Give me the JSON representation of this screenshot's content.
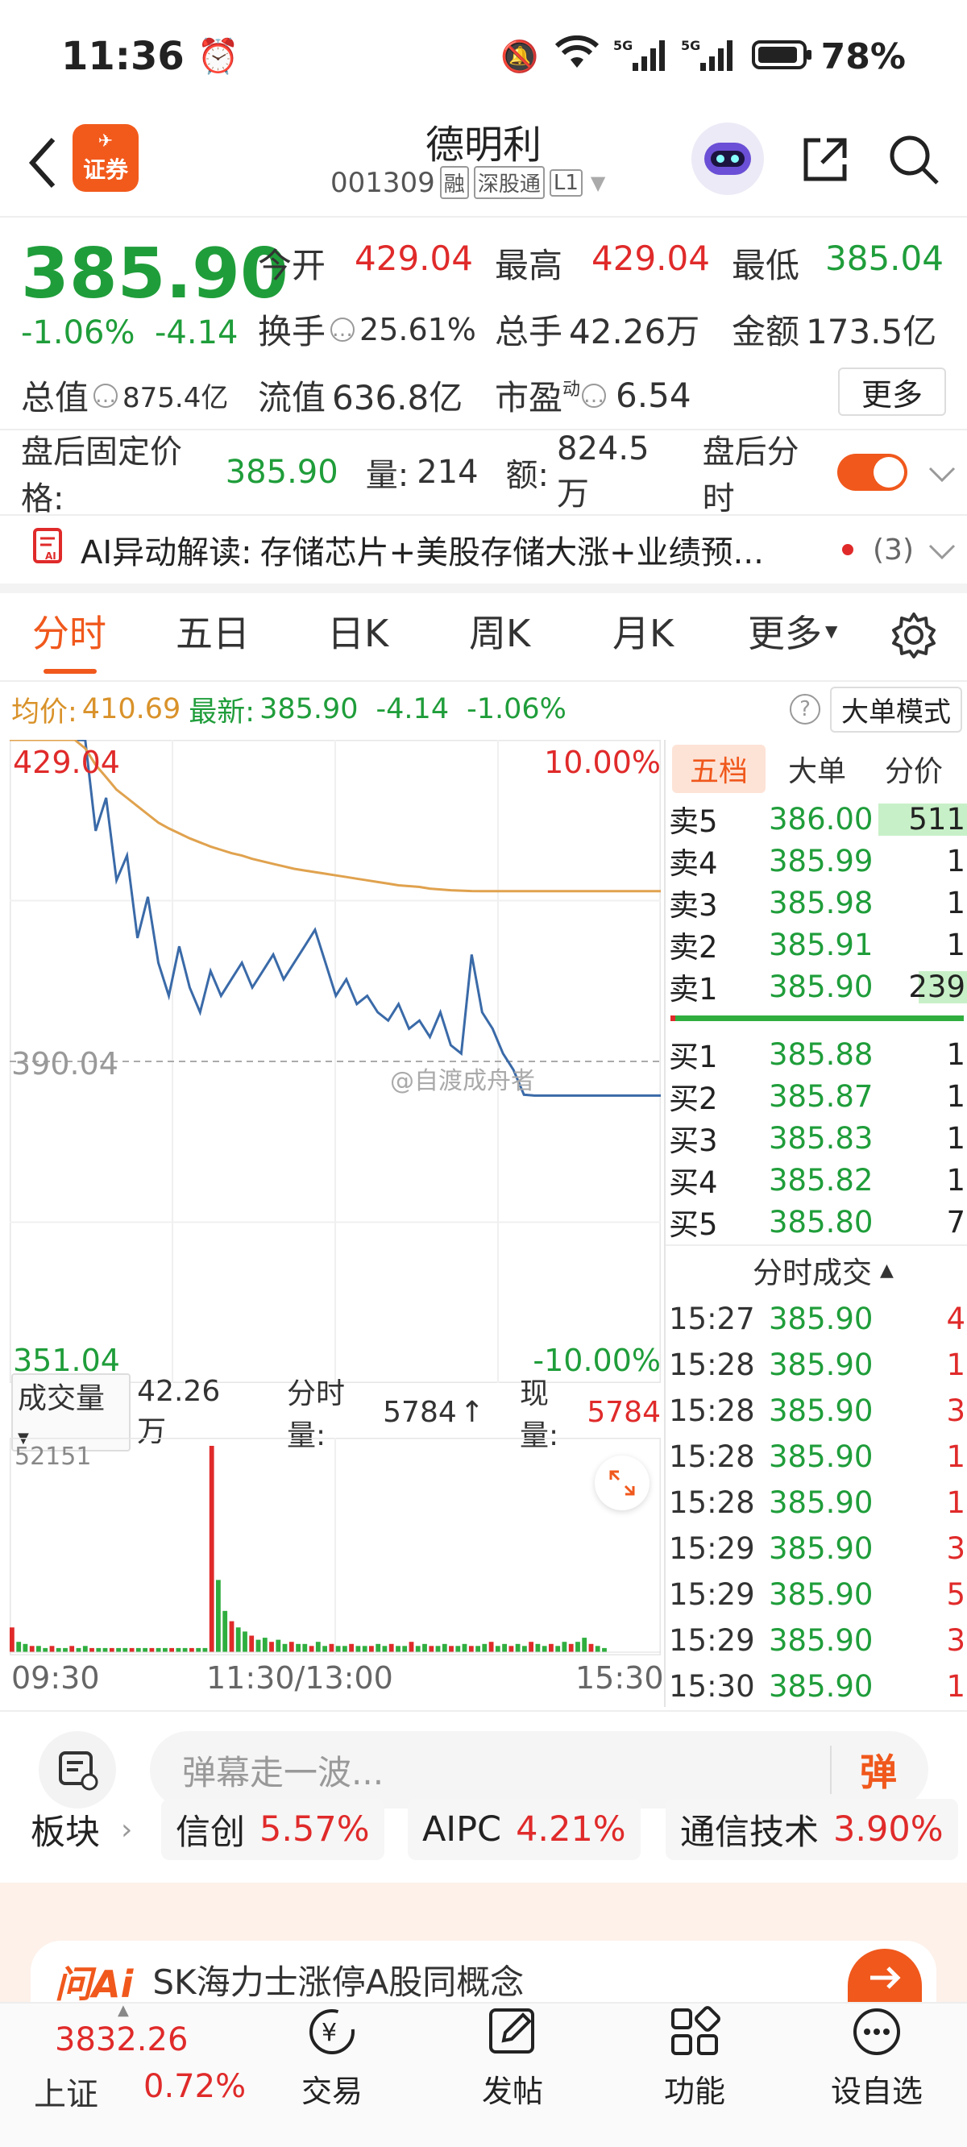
{
  "status_bar": {
    "time": "11:36",
    "battery": "78%"
  },
  "header": {
    "stock_name": "德明利",
    "code": "001309",
    "badges": [
      "融",
      "深股通",
      "L1"
    ],
    "app_logo": "证券"
  },
  "quote": {
    "price": "385.90",
    "change_pct": "-1.06%",
    "change": "-4.14",
    "open_label": "今开",
    "open": "429.04",
    "high_label": "最高",
    "high": "429.04",
    "low_label": "最低",
    "low": "385.04",
    "turnover_label": "换手",
    "turnover": "25.61%",
    "volume_label": "总手",
    "volume": "42.26万",
    "amount_label": "金额",
    "amount": "173.5亿",
    "mcap_label": "总值",
    "mcap": "875.4亿",
    "float_label": "流值",
    "float": "636.8亿",
    "pe_label": "市盈",
    "pe_sup": "动",
    "pe": "6.54",
    "more_btn": "更多"
  },
  "after_hours": {
    "label": "盘后固定价格:",
    "price": "385.90",
    "vol_label": "量:",
    "vol": "214",
    "amt_label": "额:",
    "amt": "824.5万",
    "toggle_label": "盘后分时"
  },
  "ai_bar": {
    "label": "AI异动解读:",
    "text": "存储芯片+美股存储大涨+业绩预...",
    "count": "(3)"
  },
  "tabs": [
    "分时",
    "五日",
    "日K",
    "周K",
    "月K",
    "更多"
  ],
  "avg_bar": {
    "avg_label": "均价:",
    "avg": "410.69",
    "latest_label": "最新:",
    "latest": "385.90",
    "chg": "-4.14",
    "pct": "-1.06%",
    "mode_btn": "大单模式"
  },
  "chart_data": {
    "type": "line",
    "y_top": "429.04",
    "y_mid": "390.04",
    "y_bottom": "351.04",
    "pct_top": "10.00%",
    "pct_bottom": "-10.00%",
    "ylim": [
      351.04,
      429.04
    ],
    "x_labels": [
      "09:30",
      "11:30/13:00",
      "15:30"
    ],
    "series": [
      {
        "values": [
          429.04,
          429.0,
          418,
          422,
          412,
          415,
          405,
          410,
          402,
          398,
          404,
          399,
          396,
          401,
          398,
          400,
          402,
          399,
          401,
          403,
          400,
          402,
          404,
          406,
          402,
          398,
          400,
          397,
          398,
          396,
          395,
          397,
          394,
          395,
          393,
          396,
          392,
          391,
          403,
          396,
          394,
          391,
          389,
          386,
          385.9,
          385.9,
          385.9,
          385.9,
          385.9
        ]
      },
      {
        "values": [
          429.04,
          428,
          426,
          424.5,
          423,
          422,
          421,
          420,
          419,
          418.3,
          417.7,
          417.1,
          416.6,
          416.1,
          415.7,
          415.3,
          415,
          414.6,
          414.3,
          414,
          413.7,
          413.4,
          413.2,
          413,
          412.8,
          412.6,
          412.4,
          412.2,
          412,
          411.8,
          411.6,
          411.4,
          411.3,
          411.2,
          411,
          410.9,
          410.8,
          410.75,
          410.7,
          410.69,
          410.69,
          410.69,
          410.69,
          410.69,
          410.69,
          410.69,
          410.69,
          410.69,
          410.69
        ]
      }
    ],
    "volume_max": "52151",
    "volume_values": [
      0.12,
      0.05,
      0.04,
      0.03,
      0.03,
      0.02,
      0.03,
      0.02,
      0.02,
      0.03,
      0.02,
      0.03,
      0.02,
      0.02,
      0.02,
      0.02,
      0.02,
      0.02,
      0.02,
      0.02,
      0.02,
      0.02,
      0.02,
      0.02,
      0.02,
      0.02,
      0.02,
      0.02,
      0.02,
      0.02,
      1.0,
      0.35,
      0.2,
      0.15,
      0.12,
      0.1,
      0.08,
      0.06,
      0.07,
      0.05,
      0.06,
      0.04,
      0.05,
      0.04,
      0.04,
      0.03,
      0.05,
      0.03,
      0.04,
      0.03,
      0.03,
      0.04,
      0.03,
      0.03,
      0.03,
      0.04,
      0.03,
      0.04,
      0.03,
      0.03,
      0.05,
      0.03,
      0.04,
      0.03,
      0.03,
      0.04,
      0.03,
      0.03,
      0.04,
      0.03,
      0.03,
      0.04,
      0.05,
      0.03,
      0.04,
      0.03,
      0.04,
      0.03,
      0.05,
      0.04,
      0.03,
      0.04,
      0.03,
      0.05,
      0.04,
      0.05,
      0.07,
      0.04,
      0.03,
      0.02
    ]
  },
  "volume_bar": {
    "label": "成交量",
    "total": "42.26万",
    "period_label": "分时量:",
    "period": "5784",
    "now_label": "现量:",
    "now": "5784"
  },
  "order_book": {
    "tabs": [
      "五档",
      "大单",
      "分价"
    ],
    "asks": [
      {
        "label": "卖5",
        "price": "386.00",
        "vol": "511"
      },
      {
        "label": "卖4",
        "price": "385.99",
        "vol": "1"
      },
      {
        "label": "卖3",
        "price": "385.98",
        "vol": "1"
      },
      {
        "label": "卖2",
        "price": "385.91",
        "vol": "1"
      },
      {
        "label": "卖1",
        "price": "385.90",
        "vol": "239"
      }
    ],
    "bids": [
      {
        "label": "买1",
        "price": "385.88",
        "vol": "1"
      },
      {
        "label": "买2",
        "price": "385.87",
        "vol": "1"
      },
      {
        "label": "买3",
        "price": "385.83",
        "vol": "1"
      },
      {
        "label": "买4",
        "price": "385.82",
        "vol": "1"
      },
      {
        "label": "买5",
        "price": "385.80",
        "vol": "7"
      }
    ]
  },
  "trades": {
    "title": "分时成交",
    "rows": [
      {
        "t": "15:27",
        "p": "385.90",
        "v": "4"
      },
      {
        "t": "15:28",
        "p": "385.90",
        "v": "1"
      },
      {
        "t": "15:28",
        "p": "385.90",
        "v": "3"
      },
      {
        "t": "15:28",
        "p": "385.90",
        "v": "1"
      },
      {
        "t": "15:28",
        "p": "385.90",
        "v": "1"
      },
      {
        "t": "15:29",
        "p": "385.90",
        "v": "3"
      },
      {
        "t": "15:29",
        "p": "385.90",
        "v": "5"
      },
      {
        "t": "15:29",
        "p": "385.90",
        "v": "3"
      },
      {
        "t": "15:30",
        "p": "385.90",
        "v": "1"
      }
    ]
  },
  "watermark": "@自渡成舟者",
  "comment": {
    "placeholder": "弹幕走一波...",
    "send": "弹"
  },
  "boards": {
    "label": "板块",
    "items": [
      {
        "name": "信创",
        "pct": "5.57%"
      },
      {
        "name": "AIPC",
        "pct": "4.21%"
      },
      {
        "name": "通信技术",
        "pct": "3.90%"
      }
    ]
  },
  "news": {
    "brand": "问Ai",
    "text": "SK海力士涨停A股同概念"
  },
  "bottom_nav": {
    "index_value": "3832.26",
    "index_name": "上证",
    "index_pct": "0.72%",
    "items": [
      "交易",
      "发帖",
      "功能",
      "设自选"
    ]
  }
}
